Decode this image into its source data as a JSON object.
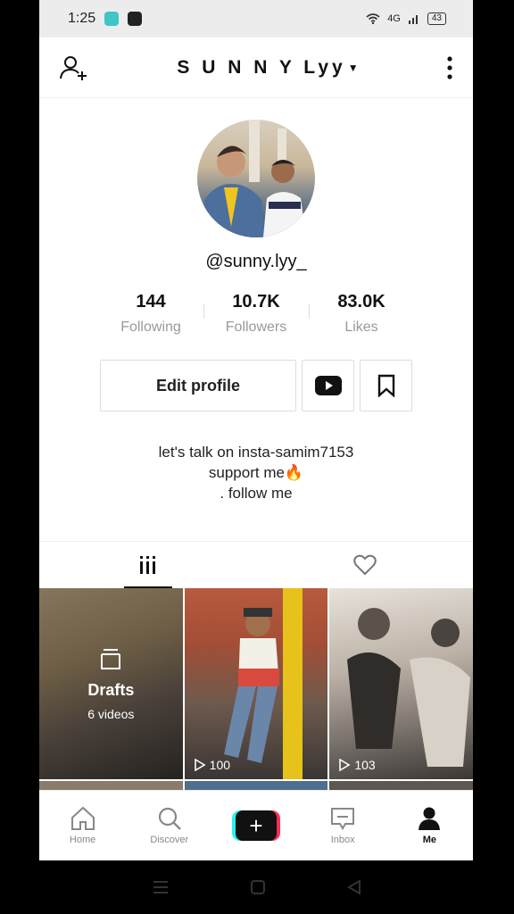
{
  "status": {
    "time": "1:25",
    "battery": "43",
    "network": "4G"
  },
  "header": {
    "title": "S U N N Y Lyy",
    "dropdown_icon": "caret-down-icon"
  },
  "profile": {
    "username": "@sunny.lyy_"
  },
  "stats": [
    {
      "value": "144",
      "label": "Following"
    },
    {
      "value": "10.7K",
      "label": "Followers"
    },
    {
      "value": "83.0K",
      "label": "Likes"
    }
  ],
  "actions": {
    "edit_label": "Edit profile"
  },
  "bio": {
    "line1": "let's talk on insta-samim7153",
    "line2": "support me🔥",
    "line3": ". follow me"
  },
  "grid": {
    "drafts_title": "Drafts",
    "drafts_count": "6 videos",
    "video2_views": "100",
    "video3_views": "103"
  },
  "nav": {
    "home": "Home",
    "discover": "Discover",
    "inbox": "Inbox",
    "me": "Me"
  },
  "colors": {
    "accent_cyan": "#25f4ee",
    "accent_red": "#fe2c55"
  }
}
